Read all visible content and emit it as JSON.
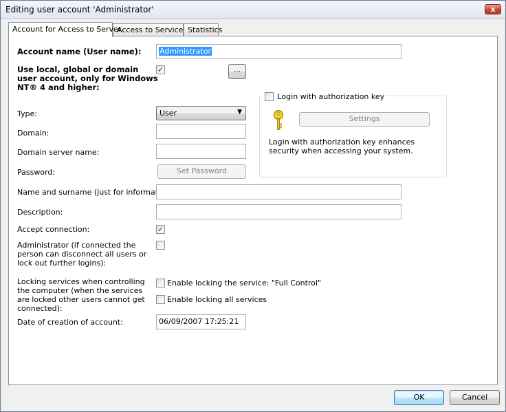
{
  "window": {
    "title": "Editing user account 'Administrator'",
    "close_glyph": "x"
  },
  "tabs": [
    {
      "label": "Account for Access to Server",
      "active": true
    },
    {
      "label": "Access to Services",
      "active": false
    },
    {
      "label": "Statistics",
      "active": false
    }
  ],
  "form": {
    "account_name_label": "Account name (User name):",
    "account_name_value": "Administrator",
    "use_local_label": "Use local, global or domain user account, only for Windows NT® 4 and higher:",
    "use_local_checked": true,
    "browse_label": "...",
    "type_label": "Type:",
    "type_value": "User",
    "domain_label": "Domain:",
    "domain_value": "",
    "domain_server_label": "Domain server name:",
    "domain_server_value": "",
    "password_label": "Password:",
    "set_password_label": "Set Password",
    "name_surname_label": "Name and surname (just for information):",
    "name_surname_value": "",
    "description_label": "Description:",
    "description_value": "",
    "accept_connection_label": "Accept connection:",
    "accept_connection_checked": true,
    "administrator_label": "Administrator (if connected the person can disconnect all users or lock out further logins):",
    "administrator_checked": false,
    "locking_label": "Locking services when controlling the computer (when the services are locked other users cannot get connected):",
    "lock_full_control_label": "Enable locking the service: \"Full Control\"",
    "lock_full_control_checked": false,
    "lock_all_label": "Enable locking all services",
    "lock_all_checked": false,
    "date_label": "Date of creation of account:",
    "date_value": "06/09/2007 17:25:21"
  },
  "auth_key": {
    "legend": "Login with authorization key",
    "checked": false,
    "settings_label": "Settings",
    "description": "Login with authorization key enhances security when accessing your system.",
    "icon": "key-icon"
  },
  "footer": {
    "ok_label": "OK",
    "cancel_label": "Cancel"
  },
  "colors": {
    "selection": "#3399ff",
    "key_gold": "#e8c300"
  }
}
